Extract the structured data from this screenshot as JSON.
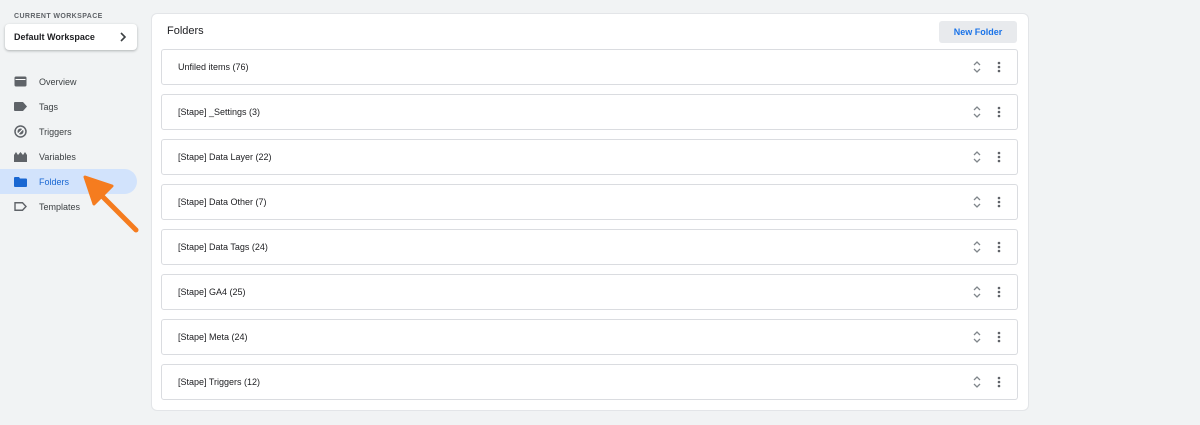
{
  "sidebar": {
    "workspace_label": "CURRENT WORKSPACE",
    "workspace_name": "Default Workspace",
    "items": [
      {
        "label": "Overview",
        "icon": "overview-icon"
      },
      {
        "label": "Tags",
        "icon": "tag-icon"
      },
      {
        "label": "Triggers",
        "icon": "trigger-icon"
      },
      {
        "label": "Variables",
        "icon": "variables-icon"
      },
      {
        "label": "Folders",
        "icon": "folder-icon",
        "active": true
      },
      {
        "label": "Templates",
        "icon": "template-icon"
      }
    ]
  },
  "main": {
    "title": "Folders",
    "new_folder_label": "New Folder",
    "folders": [
      {
        "label": "Unfiled items (76)"
      },
      {
        "label": "[Stape] _Settings (3)"
      },
      {
        "label": "[Stape] Data Layer (22)"
      },
      {
        "label": "[Stape] Data Other (7)"
      },
      {
        "label": "[Stape] Data Tags (24)"
      },
      {
        "label": "[Stape] GA4 (25)"
      },
      {
        "label": "[Stape] Meta (24)"
      },
      {
        "label": "[Stape] Triggers (12)"
      }
    ]
  },
  "colors": {
    "accent": "#1a73e8",
    "active_bg": "#d2e3fc",
    "annotation_arrow": "#f57c1f"
  }
}
